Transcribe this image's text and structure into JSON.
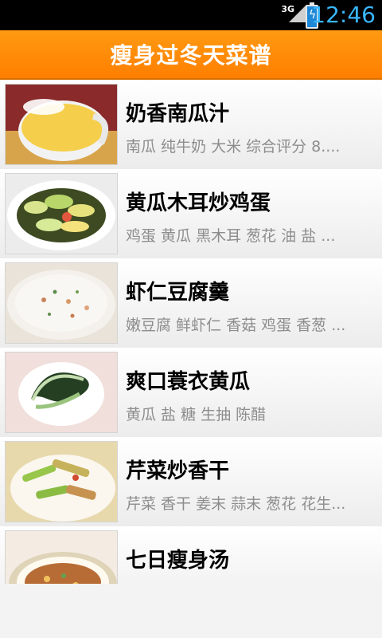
{
  "status_bar": {
    "network": "3G",
    "clock": "12:46",
    "icons": [
      "signal-icon",
      "battery-charging-icon"
    ]
  },
  "header": {
    "title": "瘦身过冬天菜谱"
  },
  "recipes": [
    {
      "title": "奶香南瓜汁",
      "ingredients": "南瓜 纯牛奶 大米 综合评分 8...."
    },
    {
      "title": "黄瓜木耳炒鸡蛋",
      "ingredients": "鸡蛋 黄瓜 黑木耳 葱花 油 盐 ..."
    },
    {
      "title": "虾仁豆腐羹",
      "ingredients": "嫩豆腐 鲜虾仁 香菇 鸡蛋 香葱 ..."
    },
    {
      "title": "爽口蓑衣黄瓜",
      "ingredients": "黄瓜 盐 糖 生抽 陈醋"
    },
    {
      "title": "芹菜炒香干",
      "ingredients": "芹菜 香干 姜末 蒜末 葱花 花生..."
    },
    {
      "title": "七日瘦身汤",
      "ingredients": ""
    }
  ],
  "colors": {
    "header": "#ff8a00",
    "status_accent": "#38b6ff"
  }
}
